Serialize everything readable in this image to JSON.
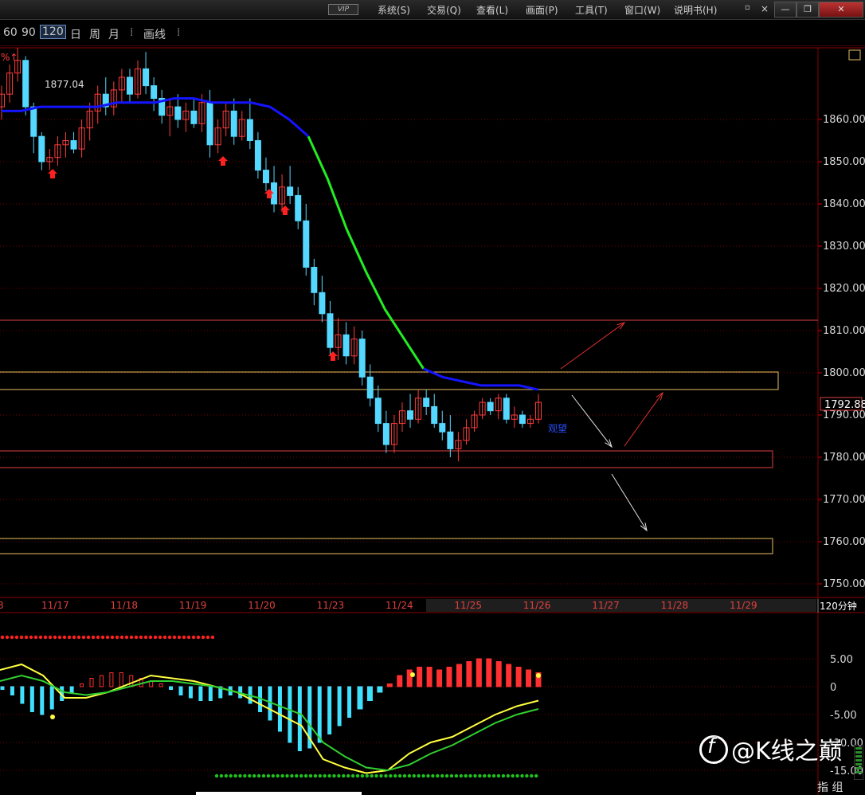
{
  "titlebar": {
    "vip": "VIP",
    "menus": [
      "系统(S)",
      "交易(Q)",
      "查看(L)",
      "画面(P)",
      "工具(T)",
      "窗口(W)",
      "说明书(H)"
    ],
    "buttons": {
      "restore": "▫",
      "close_small": "×",
      "minimize": "—",
      "maximize": "❐",
      "close": "✕"
    }
  },
  "toolbar": {
    "periods": [
      "60",
      "90",
      "120",
      "日",
      "周",
      "月"
    ],
    "selected_period": "120",
    "draw_label": "画线"
  },
  "main_chart": {
    "top_label": "%↑",
    "high_label": "1877.04",
    "current_price": "1792.88",
    "annotation": "观望",
    "period_badge": "120分钟",
    "dates": [
      "11/17",
      "11/18",
      "11/19",
      "11/20",
      "11/23",
      "11/24",
      "11/25",
      "11/26",
      "11/27",
      "11/28",
      "11/29"
    ],
    "date_cut": "8",
    "colors": {
      "up": "#ff3b3b",
      "down": "#54d8ff",
      "ma_blue": "#1414ff",
      "ma_green": "#22ee22",
      "grid": "#7a0000",
      "box": "#e8c060",
      "zone": "#e04040"
    }
  },
  "chart_data": [
    {
      "type": "candlestick",
      "title": "",
      "ylabel": "",
      "ylim": [
        1748,
        1883
      ],
      "ytick_labels": [
        "1860.00",
        "1850.00",
        "1840.00",
        "1830.00",
        "1820.00",
        "1810.00",
        "1800.00",
        "1790.00",
        "1780.00",
        "1770.00",
        "1760.00",
        "1750.00"
      ],
      "x_tick_labels": [
        "11/17",
        "11/18",
        "11/19",
        "11/20",
        "11/23",
        "11/24",
        "11/25",
        "11/26",
        "11/27",
        "11/28",
        "11/29"
      ],
      "series": [
        {
          "values": [
            [
              1863,
              1868,
              1860,
              1866
            ],
            [
              1866,
              1873,
              1864,
              1871
            ],
            [
              1871,
              1877,
              1869,
              1874
            ],
            [
              1874,
              1875,
              1861,
              1863
            ],
            [
              1863,
              1864,
              1852,
              1856
            ],
            [
              1856,
              1857,
              1848,
              1850
            ],
            [
              1850,
              1853,
              1848,
              1851
            ],
            [
              1851,
              1856,
              1849,
              1854
            ],
            [
              1854,
              1857,
              1851,
              1855
            ],
            [
              1855,
              1857,
              1852,
              1853
            ],
            [
              1853,
              1860,
              1851,
              1858
            ],
            [
              1858,
              1864,
              1855,
              1862
            ],
            [
              1862,
              1868,
              1859,
              1866
            ],
            [
              1866,
              1870,
              1861,
              1863
            ],
            [
              1863,
              1869,
              1861,
              1867
            ],
            [
              1867,
              1872,
              1864,
              1870
            ],
            [
              1870,
              1872,
              1864,
              1866
            ],
            [
              1866,
              1874,
              1865,
              1872
            ],
            [
              1872,
              1876,
              1866,
              1868
            ],
            [
              1868,
              1870,
              1862,
              1865
            ],
            [
              1865,
              1867,
              1859,
              1861
            ],
            [
              1861,
              1865,
              1856,
              1863
            ],
            [
              1863,
              1866,
              1858,
              1860
            ],
            [
              1860,
              1864,
              1857,
              1862
            ],
            [
              1862,
              1865,
              1858,
              1859
            ],
            [
              1859,
              1866,
              1857,
              1864
            ],
            [
              1864,
              1867,
              1851,
              1854
            ],
            [
              1854,
              1860,
              1852,
              1858
            ],
            [
              1858,
              1864,
              1856,
              1862
            ],
            [
              1862,
              1865,
              1854,
              1856
            ],
            [
              1856,
              1862,
              1855,
              1860
            ],
            [
              1860,
              1865,
              1853,
              1855
            ],
            [
              1855,
              1857,
              1846,
              1848
            ],
            [
              1848,
              1851,
              1843,
              1845
            ],
            [
              1845,
              1849,
              1838,
              1840
            ],
            [
              1840,
              1847,
              1838,
              1844
            ],
            [
              1844,
              1849,
              1840,
              1842
            ],
            [
              1842,
              1844,
              1834,
              1836
            ],
            [
              1836,
              1840,
              1823,
              1825
            ],
            [
              1825,
              1827,
              1816,
              1819
            ],
            [
              1819,
              1823,
              1812,
              1814
            ],
            [
              1814,
              1817,
              1804,
              1806
            ],
            [
              1806,
              1813,
              1803,
              1809
            ],
            [
              1809,
              1812,
              1802,
              1804
            ],
            [
              1804,
              1811,
              1802,
              1808
            ],
            [
              1808,
              1810,
              1797,
              1799
            ],
            [
              1799,
              1802,
              1792,
              1794
            ],
            [
              1794,
              1797,
              1786,
              1788
            ],
            [
              1788,
              1791,
              1781,
              1783
            ],
            [
              1783,
              1790,
              1781,
              1788
            ],
            [
              1788,
              1793,
              1786,
              1791
            ],
            [
              1791,
              1795,
              1787,
              1789
            ],
            [
              1789,
              1796,
              1788,
              1794
            ],
            [
              1794,
              1796,
              1790,
              1792
            ],
            [
              1792,
              1795,
              1787,
              1788
            ],
            [
              1788,
              1791,
              1784,
              1786
            ],
            [
              1786,
              1790,
              1780,
              1782
            ],
            [
              1782,
              1786,
              1779,
              1784
            ],
            [
              1784,
              1789,
              1783,
              1787
            ],
            [
              1787,
              1791,
              1786,
              1790
            ],
            [
              1790,
              1794,
              1789,
              1793
            ],
            [
              1793,
              1794,
              1790,
              1791
            ],
            [
              1791,
              1795,
              1789,
              1794
            ],
            [
              1794,
              1795,
              1788,
              1789
            ],
            [
              1789,
              1792,
              1787,
              1790
            ],
            [
              1790,
              1791,
              1787,
              1788
            ],
            [
              1788,
              1790,
              1787,
              1789
            ],
            [
              1789,
              1795,
              1788,
              1793
            ]
          ]
        },
        {
          "name": "",
          "values": [
            1862,
            1862,
            1863,
            1863,
            1863,
            1863,
            1864,
            1864,
            1864,
            1865,
            1865,
            1864,
            1864,
            1864,
            1863,
            1860,
            1856,
            1846,
            1834,
            1824,
            1815,
            1808,
            1801,
            1799,
            1798,
            1797,
            1797,
            1797,
            1796
          ]
        }
      ]
    },
    {
      "type": "bar",
      "title": "",
      "ytick_labels": [
        "5.00",
        "0",
        "-5.00",
        "-10.00",
        "-15.00"
      ],
      "ylim": [
        -16,
        10
      ],
      "histogram": [
        -0.5,
        -1.5,
        -3,
        -4.5,
        -5,
        -4,
        -2.5,
        -1,
        0.5,
        1.5,
        2,
        2.5,
        2.5,
        2,
        1.5,
        1,
        0.5,
        -0.5,
        -1.5,
        -2,
        -2.5,
        -2.5,
        -2,
        -1.5,
        -2,
        -3,
        -4.5,
        -6,
        -8,
        -10,
        -11.5,
        -11,
        -10,
        -8.5,
        -7,
        -5.5,
        -4,
        -2.5,
        -1,
        0.5,
        2,
        3,
        3.5,
        3.5,
        3,
        3.5,
        4,
        4.5,
        5,
        5,
        4.5,
        4,
        3.5,
        3,
        2.5
      ],
      "series": [
        {
          "name": "",
          "values": [
            3,
            4,
            2,
            -2,
            -2,
            -1,
            0.5,
            2,
            1.5,
            1,
            0,
            -1,
            -3,
            -5,
            -7,
            -13,
            -14.5,
            -15.5,
            -15,
            -12,
            -10,
            -9,
            -7,
            -5,
            -3.5,
            -2.5
          ]
        },
        {
          "name": "",
          "values": [
            1,
            2,
            1,
            -1,
            -1.5,
            -1,
            0,
            1,
            1,
            0.5,
            0,
            -1,
            -2,
            -3.5,
            -5,
            -10,
            -12.5,
            -14.5,
            -15,
            -14,
            -12,
            -10.5,
            -8.5,
            -6.5,
            -5,
            -4
          ]
        }
      ]
    }
  ],
  "watermark": "@K线之巅",
  "bottom_bar": "指 组"
}
